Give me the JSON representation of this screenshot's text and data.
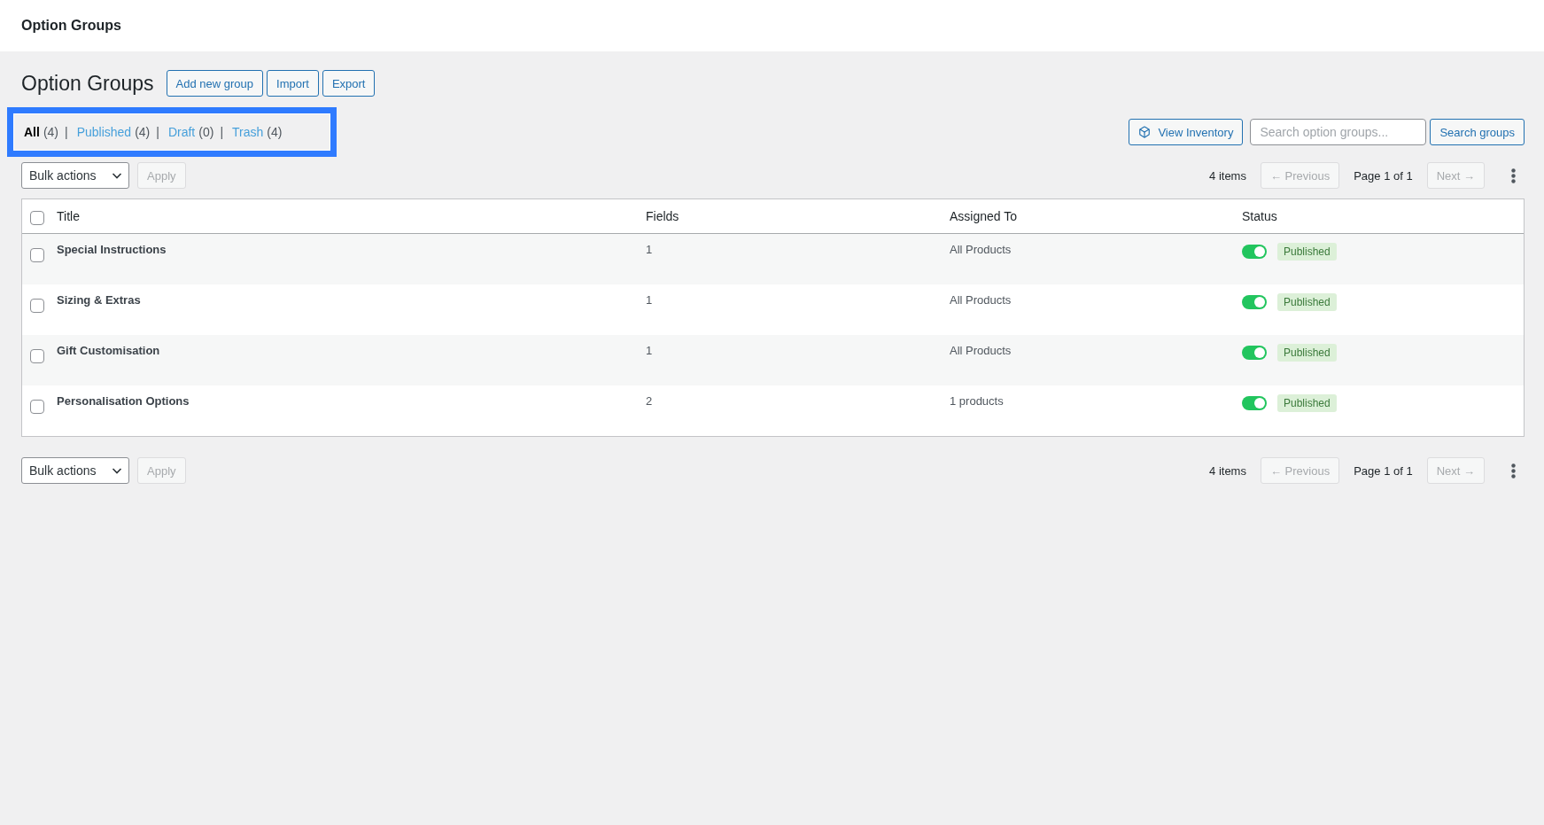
{
  "top_bar": {
    "title": "Option Groups"
  },
  "page_header": {
    "title": "Option Groups",
    "buttons": [
      "Add new group",
      "Import",
      "Export"
    ]
  },
  "filter_bar": {
    "highlighted": true,
    "items": [
      {
        "label": "All",
        "count": "(4)",
        "selected": true,
        "separator": "|"
      },
      {
        "label": "Published",
        "count": "(4)",
        "selected": false,
        "separator": "|"
      },
      {
        "label": "Draft",
        "count": "(0)",
        "selected": false,
        "separator": "|"
      },
      {
        "label": "Trash",
        "count": "(4)",
        "selected": false
      }
    ]
  },
  "toolbar": {
    "view_inventory": "View Inventory",
    "search": {
      "placeholder": "Search option groups..."
    },
    "search_button": "Search groups"
  },
  "top_nav": {
    "bulk_actions": "Bulk actions",
    "apply": {
      "label": "Apply",
      "disabled": true
    },
    "item_count": "4 items",
    "previous": {
      "label": "← Previous",
      "disabled": true
    },
    "page_info": "Page 1 of 1",
    "next": {
      "label": "Next →",
      "disabled": true
    }
  },
  "table": {
    "columns": [
      "Title",
      "Fields",
      "Assigned To",
      "Status"
    ],
    "select_all_checked": false,
    "rows": [
      {
        "checked": false,
        "title": "Special Instructions",
        "fields": "1",
        "assigned_to": "All Products",
        "enabled": true,
        "status": "Published"
      },
      {
        "checked": false,
        "title": "Sizing & Extras",
        "fields": "1",
        "assigned_to": "All Products",
        "enabled": true,
        "status": "Published"
      },
      {
        "checked": false,
        "title": "Gift Customisation",
        "fields": "1",
        "assigned_to": "All Products",
        "enabled": true,
        "status": "Published"
      },
      {
        "checked": false,
        "title": "Personalisation Options",
        "fields": "2",
        "assigned_to": "1 products",
        "enabled": true,
        "status": "Published"
      }
    ]
  },
  "bottom_nav": {
    "bulk_actions": "Bulk actions",
    "apply": {
      "label": "Apply",
      "disabled": true
    },
    "item_count": "4 items",
    "previous": {
      "label": "← Previous",
      "disabled": true
    },
    "page_info": "Page 1 of 1",
    "next": {
      "label": "Next →",
      "disabled": true
    }
  }
}
